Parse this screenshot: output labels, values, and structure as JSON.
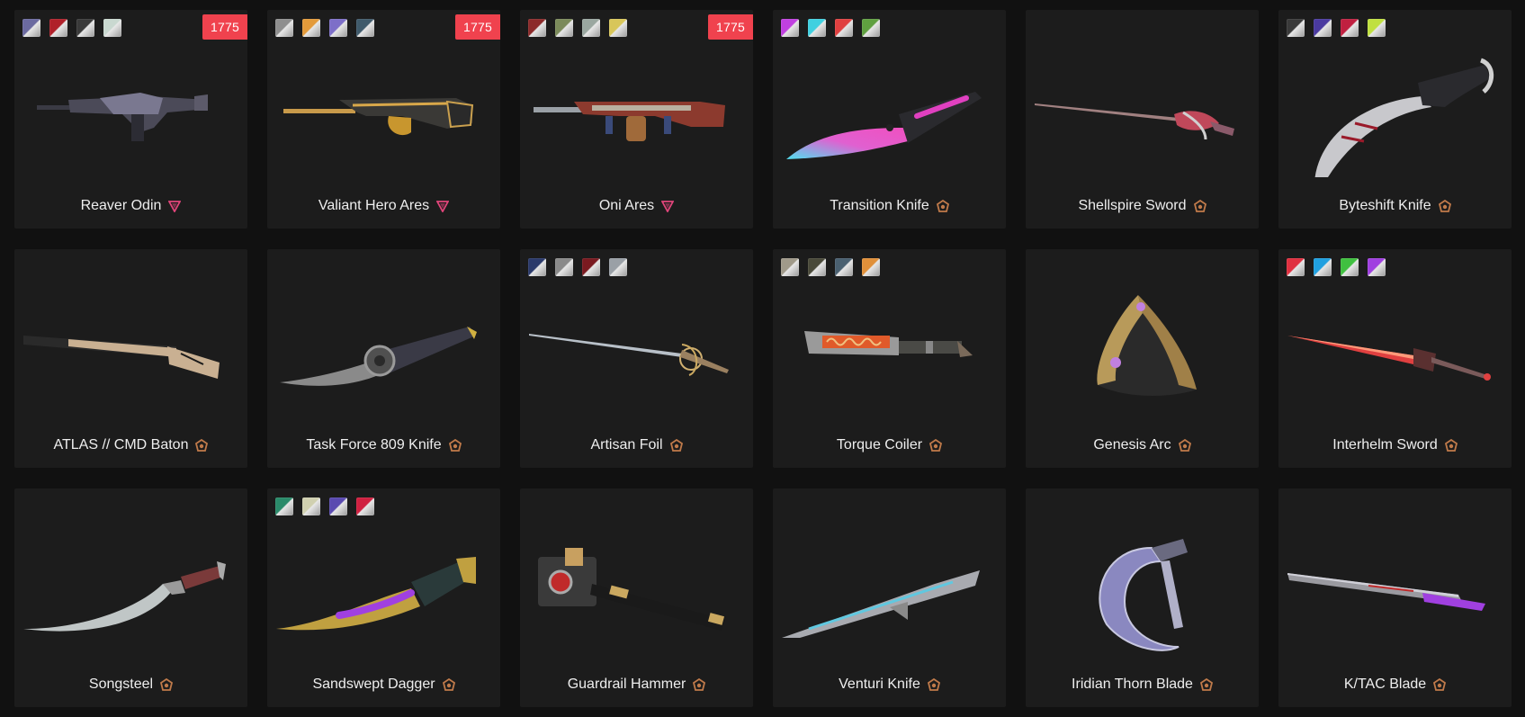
{
  "items": [
    {
      "name": "Reaver Odin",
      "tier": "ultra-icon",
      "price": "1775",
      "swatches": [
        "#6b6aa0",
        "#b0202a",
        "#3a3a3a",
        "#c9d8d0"
      ]
    },
    {
      "name": "Valiant Hero Ares",
      "tier": "ultra-icon",
      "price": "1775",
      "swatches": [
        "#8f8f8f",
        "#e39a3a",
        "#7d6fc8",
        "#3f5a6b"
      ]
    },
    {
      "name": "Oni Ares",
      "tier": "ultra-icon",
      "price": "1775",
      "swatches": [
        "#8c2a2a",
        "#7b8a5a",
        "#9aa7a0",
        "#d8c65a"
      ]
    },
    {
      "name": "Transition Knife",
      "tier": "premium-icon",
      "price": "",
      "swatches": [
        "#c040e0",
        "#40d0e0",
        "#e04040",
        "#60a040"
      ]
    },
    {
      "name": "Shellspire Sword",
      "tier": "premium-icon",
      "price": "",
      "swatches": []
    },
    {
      "name": "Byteshift Knife",
      "tier": "premium-icon",
      "price": "",
      "swatches": [
        "#3a3a3a",
        "#4a3aa0",
        "#c02040",
        "#c0e040"
      ]
    },
    {
      "name": "ATLAS // CMD Baton",
      "tier": "premium-icon",
      "price": "",
      "swatches": []
    },
    {
      "name": "Task Force 809 Knife",
      "tier": "premium-icon",
      "price": "",
      "swatches": []
    },
    {
      "name": "Artisan Foil",
      "tier": "premium-icon",
      "price": "",
      "swatches": [
        "#2b3a6b",
        "#8a8a8a",
        "#7a1a20",
        "#9aa0a6"
      ]
    },
    {
      "name": "Torque Coiler",
      "tier": "premium-icon",
      "price": "",
      "swatches": [
        "#a09a8a",
        "#4a4a3a",
        "#4a6070",
        "#e0903a"
      ]
    },
    {
      "name": "Genesis Arc",
      "tier": "premium-icon",
      "price": "",
      "swatches": []
    },
    {
      "name": "Interhelm Sword",
      "tier": "premium-icon",
      "price": "",
      "swatches": [
        "#e03040",
        "#20a0e0",
        "#40c040",
        "#a040e0"
      ]
    },
    {
      "name": "Songsteel",
      "tier": "premium-icon",
      "price": "",
      "swatches": []
    },
    {
      "name": "Sandswept Dagger",
      "tier": "premium-icon",
      "price": "",
      "swatches": [
        "#2a8a6a",
        "#d0d0b0",
        "#5a4ab0",
        "#d02040"
      ]
    },
    {
      "name": "Guardrail Hammer",
      "tier": "premium-icon",
      "price": "",
      "swatches": []
    },
    {
      "name": "Venturi Knife",
      "tier": "premium-icon",
      "price": "",
      "swatches": []
    },
    {
      "name": "Iridian Thorn Blade",
      "tier": "premium-icon",
      "price": "",
      "swatches": []
    },
    {
      "name": "K/TAC Blade",
      "tier": "premium-icon",
      "price": "",
      "swatches": []
    }
  ],
  "colors": {
    "background": "#111111",
    "card": "#1c1c1c",
    "price_badge": "#f0424e",
    "ultra_tier": "#e0457a",
    "premium_tier": "#c07a4a"
  }
}
